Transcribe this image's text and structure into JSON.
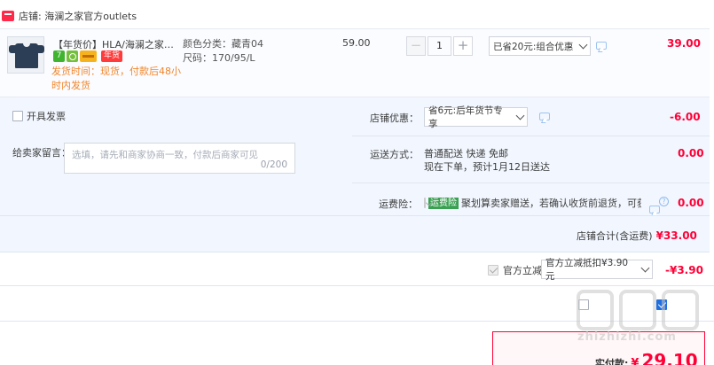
{
  "store": {
    "label": "店铺: 海澜之家官方outlets"
  },
  "item": {
    "title": "【年货价】HLA/海澜之家舒适...",
    "badges": {
      "seven": "7",
      "new_year": "年货"
    },
    "ship_note": "发货时间：现货，付款后48小时内发货",
    "sku_color": "颜色分类：藏青04",
    "sku_size": "尺码：170/95/L",
    "unit_price": "59.00",
    "quantity": "1",
    "discount_select": "已省20元:组合优惠",
    "subtotal": "39.00"
  },
  "options": {
    "invoice_label": "开具发票",
    "message_label": "给卖家留言：",
    "message_placeholder": "选填，请先和商家协商一致，付款后商家可见",
    "message_count": "0/200",
    "shop_discount_label": "店铺优惠：",
    "shop_discount_select": "省6元:后年货节专享",
    "shop_discount_amount": "-6.00",
    "shipping_label": "运送方式：",
    "shipping_method": "普通配送 快递 免邮",
    "shipping_eta": "现在下单，预计1月12日送达",
    "shipping_amount": "0.00",
    "insurance_label": "运费险：",
    "insurance_tag": "运费险",
    "insurance_text": "聚划算卖家赠送，若确认收货前退货，可获...",
    "insurance_amount": "0.00",
    "shop_total_label": "店铺合计(含运费)",
    "shop_total_amount": "¥33.00"
  },
  "official_discount": {
    "label": "官方立减",
    "select": "官方立减抵扣¥3.90元",
    "amount": "-¥3.90"
  },
  "bottom": {
    "pay_label": "实付款:",
    "pay_symbol": "¥",
    "pay_amount": "29.10"
  },
  "watermark": {
    "text": "zhizhizhi.com"
  },
  "colors": {
    "accent_red": "#ff0036",
    "ship_note_orange": "#f2862b",
    "panel_blue": "#f2f7ff"
  }
}
